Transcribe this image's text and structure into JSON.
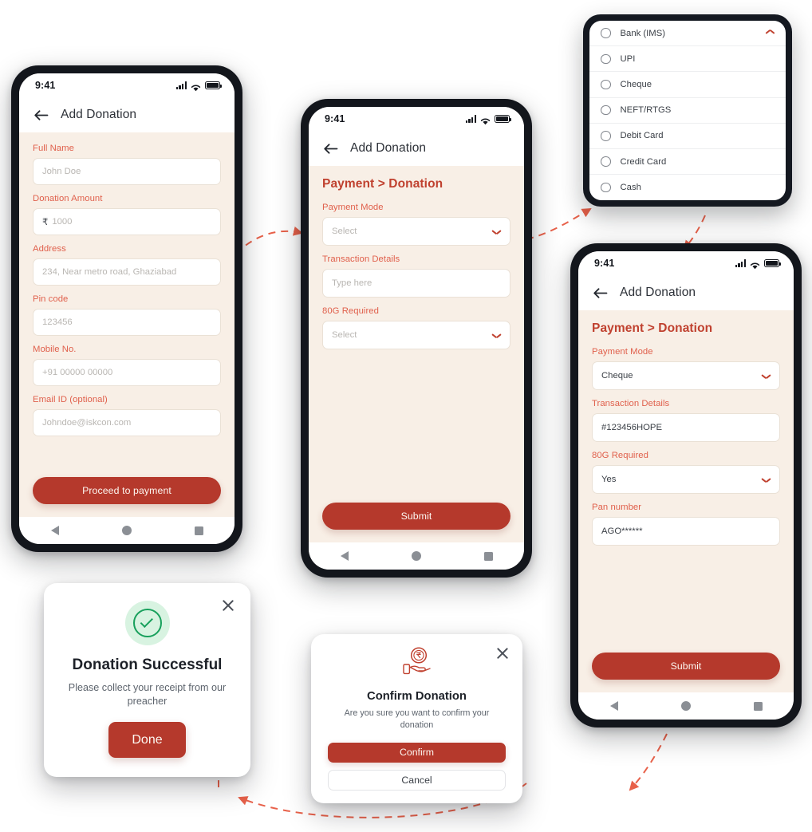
{
  "status_bar": {
    "time": "9:41",
    "icons": [
      "signal-icon",
      "wifi-icon",
      "battery-icon"
    ]
  },
  "colors": {
    "brand_red": "#b5392c",
    "heading_red": "#c0412f",
    "label_salmon": "#e0604c",
    "screen_cream": "#f8efe6",
    "success_green": "#18a05c",
    "connector": "#e8614a"
  },
  "screen_form": {
    "appbar_title": "Add Donation",
    "fields": [
      {
        "label": "Full Name",
        "placeholder": "John Doe",
        "value": "",
        "type": "text"
      },
      {
        "label": "Donation Amount",
        "placeholder": "1000",
        "value": "",
        "prefix": "₹",
        "type": "amount"
      },
      {
        "label": "Address",
        "placeholder": "234, Near metro road, Ghaziabad",
        "value": "",
        "type": "text"
      },
      {
        "label": "Pin code",
        "placeholder": "123456",
        "value": "",
        "type": "text"
      },
      {
        "label": "Mobile No.",
        "placeholder": "+91 00000 00000",
        "value": "",
        "type": "text"
      },
      {
        "label": "Email ID (optional)",
        "placeholder": "Johndoe@iskcon.com",
        "value": "",
        "type": "text"
      }
    ],
    "cta_label": "Proceed to payment"
  },
  "screen_payment_empty": {
    "appbar_title": "Add Donation",
    "heading": "Payment > Donation",
    "fields": [
      {
        "label": "Payment Mode",
        "placeholder": "Select",
        "value": "",
        "type": "select"
      },
      {
        "label": "Transaction Details",
        "placeholder": "Type here",
        "value": "",
        "type": "text"
      },
      {
        "label": "80G Required",
        "placeholder": "Select",
        "value": "",
        "type": "select"
      }
    ],
    "cta_label": "Submit"
  },
  "screen_payment_filled": {
    "appbar_title": "Add Donation",
    "heading": "Payment > Donation",
    "fields": [
      {
        "label": "Payment Mode",
        "placeholder": "Select",
        "value": "Cheque",
        "type": "select"
      },
      {
        "label": "Transaction Details",
        "placeholder": "Type here",
        "value": "#123456HOPE",
        "type": "text"
      },
      {
        "label": "80G Required",
        "placeholder": "Select",
        "value": "Yes",
        "type": "select"
      },
      {
        "label": "Pan number",
        "placeholder": "",
        "value": "AGO******",
        "type": "text"
      }
    ],
    "cta_label": "Submit"
  },
  "payment_mode_dropdown": {
    "expanded": true,
    "toggle_icon": "chevron-up-icon",
    "options": [
      {
        "label": "Bank (IMS)",
        "selected": false
      },
      {
        "label": "UPI",
        "selected": false
      },
      {
        "label": "Cheque",
        "selected": false
      },
      {
        "label": "NEFT/RTGS",
        "selected": false
      },
      {
        "label": "Debit Card",
        "selected": false
      },
      {
        "label": "Credit Card",
        "selected": false
      },
      {
        "label": "Cash",
        "selected": false
      }
    ]
  },
  "modal_success": {
    "icon": "check-circle-icon",
    "close_icon": "close-icon",
    "title": "Donation Successful",
    "subtitle": "Please collect your receipt from our preacher",
    "button_label": "Done"
  },
  "modal_confirm": {
    "icon": "hand-holding-rupee-icon",
    "close_icon": "close-icon",
    "title": "Confirm Donation",
    "subtitle": "Are you sure you want to confirm your donation",
    "confirm_label": "Confirm",
    "cancel_label": "Cancel"
  },
  "nav_bar": {
    "back": "nav-back-icon",
    "home": "nav-home-icon",
    "recent": "nav-recent-icon"
  }
}
